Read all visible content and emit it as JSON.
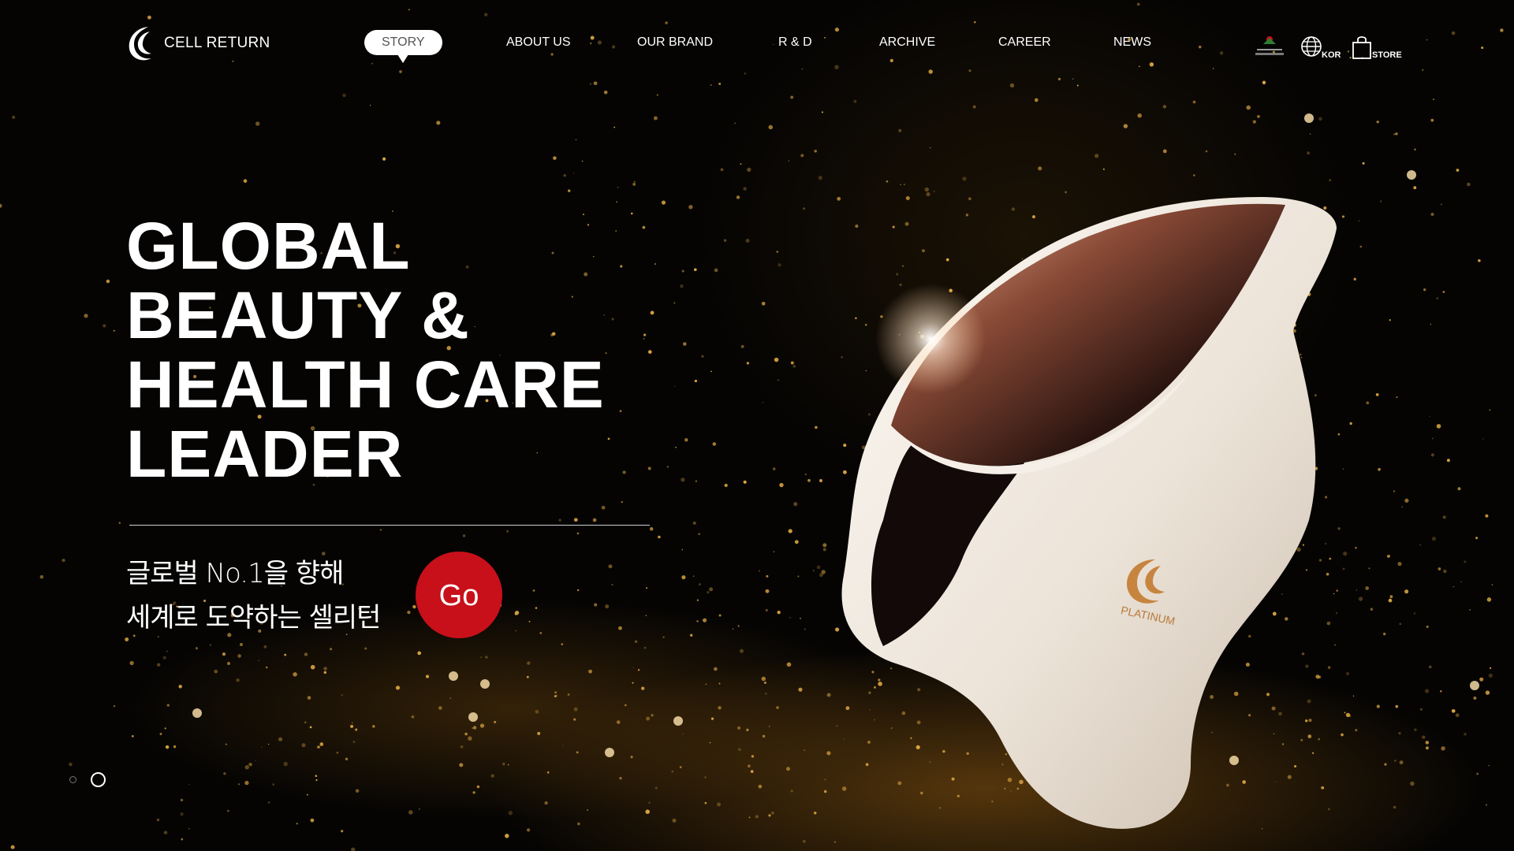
{
  "header": {
    "logo_text": "CELL RETURN",
    "nav": [
      {
        "label": "STORY",
        "active": true
      },
      {
        "label": "ABOUT US",
        "active": false
      },
      {
        "label": "OUR BRAND",
        "active": false
      },
      {
        "label": "R & D",
        "active": false
      },
      {
        "label": "ARCHIVE",
        "active": false
      },
      {
        "label": "CAREER",
        "active": false
      },
      {
        "label": "NEWS",
        "active": false
      }
    ],
    "utils": {
      "language_label": "KOR",
      "store_label": "STORE"
    }
  },
  "hero": {
    "title_lines": [
      "GLOBAL",
      "BEAUTY &",
      "HEALTH CARE",
      "LEADER"
    ],
    "subtitle_lines": [
      "글로벌 No.1을 향해",
      "세계로 도약하는 셀리턴"
    ],
    "go_label": "Go"
  },
  "product": {
    "badge_text": "PLATINUM"
  },
  "pager": {
    "total": 2,
    "active_index": 1
  },
  "colors": {
    "accent_red": "#c8101a",
    "background": "#050403",
    "glitter_gold": "#d9a441",
    "mask_white": "#f1ebe3",
    "visor_copper": "#b5674a"
  }
}
